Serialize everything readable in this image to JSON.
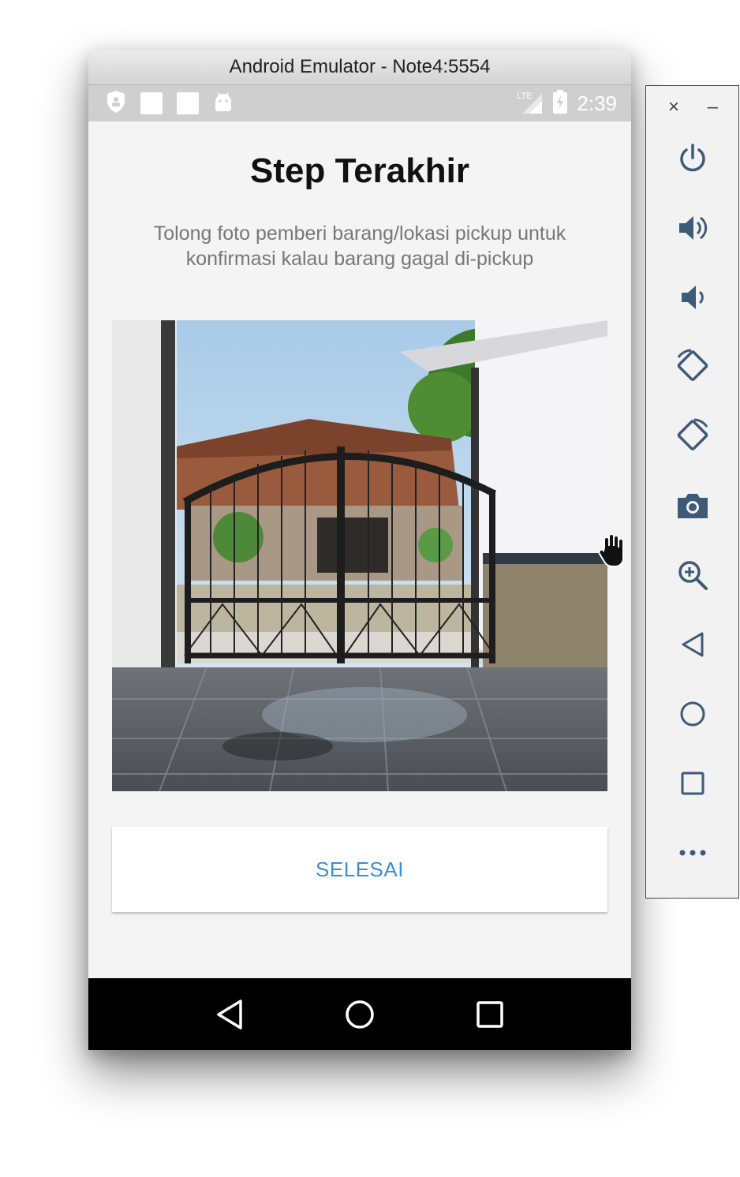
{
  "window": {
    "title": "Android Emulator - Note4:5554"
  },
  "status_bar": {
    "network": "LTE",
    "time": "2:39"
  },
  "screen": {
    "title": "Step Terakhir",
    "subtitle": "Tolong foto pemberi barang/lokasi pickup untuk konfirmasi kalau barang gagal di-pickup",
    "done_button": "SELESAI",
    "button_color": "#3a8fd6"
  },
  "nav_bar": {
    "icons": [
      "back-icon",
      "home-icon",
      "recents-icon"
    ]
  },
  "toolbar": {
    "close_label": "×",
    "minimize_label": "–",
    "icons": [
      "power-icon",
      "volume-up-icon",
      "volume-down-icon",
      "rotate-left-icon",
      "rotate-right-icon",
      "camera-icon",
      "zoom-icon",
      "back-icon",
      "home-icon",
      "overview-icon",
      "more-icon"
    ]
  }
}
